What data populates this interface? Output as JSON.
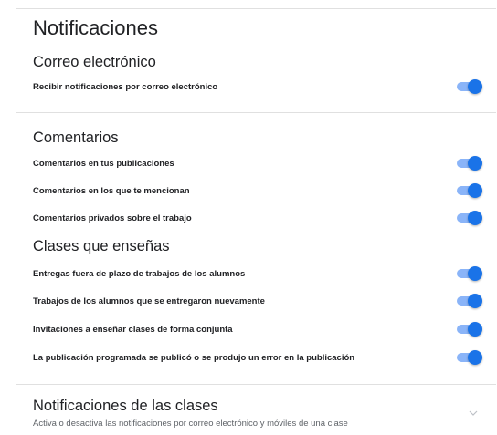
{
  "page": {
    "title": "Notificaciones"
  },
  "email": {
    "title": "Correo electrónico",
    "items": [
      {
        "label": "Recibir notificaciones por correo electrónico",
        "enabled": true
      }
    ]
  },
  "comments": {
    "title": "Comentarios",
    "items": [
      {
        "label": "Comentarios en tus publicaciones",
        "enabled": true
      },
      {
        "label": "Comentarios en los que te mencionan",
        "enabled": true
      },
      {
        "label": "Comentarios privados sobre el trabajo",
        "enabled": true
      }
    ]
  },
  "teaching": {
    "title": "Clases que enseñas",
    "items": [
      {
        "label": "Entregas fuera de plazo de trabajos de los alumnos",
        "enabled": true
      },
      {
        "label": "Trabajos de los alumnos que se entregaron nuevamente",
        "enabled": true
      },
      {
        "label": "Invitaciones a enseñar clases de forma conjunta",
        "enabled": true
      },
      {
        "label": "La publicación programada se publicó o se produjo un error en la publicación",
        "enabled": true
      }
    ]
  },
  "class_notifications": {
    "title": "Notificaciones de las clases",
    "subtitle": "Activa o desactiva las notificaciones por correo electrónico y móviles de una clase"
  },
  "colors": {
    "toggle_thumb_on": "#1a73e8",
    "toggle_track_on": "#8ab4f8",
    "divider": "#e0e0e0"
  }
}
